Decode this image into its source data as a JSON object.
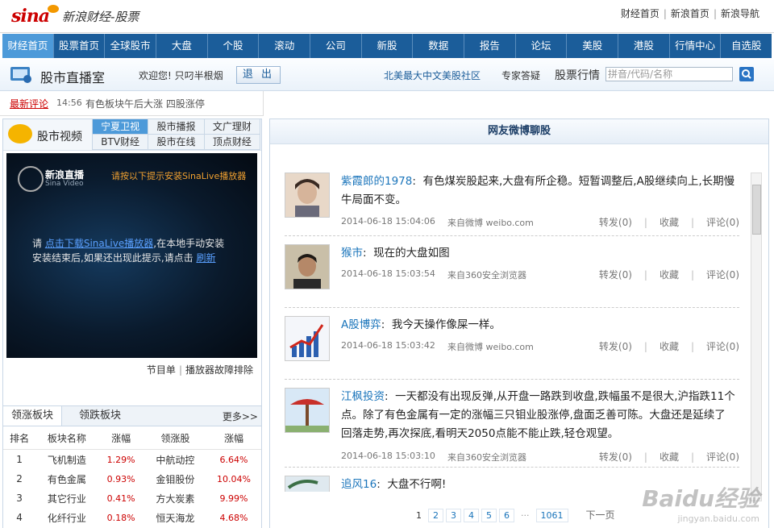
{
  "brand": {
    "logo": "sina",
    "name": "新浪财经-股票"
  },
  "top_links": [
    "财经首页",
    "新浪首页",
    "新浪导航"
  ],
  "nav": [
    "财经首页",
    "股票首页",
    "全球股市",
    "大盘",
    "个股",
    "滚动",
    "公司",
    "新股",
    "数据",
    "报告",
    "论坛",
    "美股",
    "港股",
    "行情中心",
    "自选股"
  ],
  "room": {
    "title": "股市直播室",
    "welcome": "欢迎您!  只叼半根烟",
    "logout": "退 出",
    "community": "北美最大中文美股社区",
    "expert": "专家答疑",
    "quote_label": "股票行情",
    "search_placeholder": "拼音/代码/名称"
  },
  "ticker": {
    "label": "最新评论",
    "time": "14:56",
    "text": "有色板块午后大涨  四股涨停"
  },
  "video": {
    "title": "股市视频",
    "tabs": [
      "宁夏卫视",
      "股市播报",
      "文广理财",
      "BTV财经",
      "股市在线",
      "顶点财经"
    ],
    "player_name": "新浪直播",
    "player_sub": "Sina Video",
    "player_hint": "请按以下提示安装SinaLive播放器",
    "msg_1": "请 ",
    "msg_link": "点击下载SinaLive播放器",
    "msg_2": ",在本地手动安装",
    "msg_3": "安装结束后,如果还出现此提示,请点击 ",
    "msg_refresh": "刷新",
    "links": [
      "节目单",
      "播放器故障排除"
    ]
  },
  "sectors": {
    "tabs": [
      "领涨板块",
      "领跌板块"
    ],
    "more": "更多>>",
    "headers": [
      "排名",
      "板块名称",
      "涨幅",
      "领涨股",
      "涨幅"
    ],
    "rows": [
      [
        "1",
        "飞机制造",
        "1.29%",
        "中航动控",
        "6.64%"
      ],
      [
        "2",
        "有色金属",
        "0.93%",
        "金钼股份",
        "10.04%"
      ],
      [
        "3",
        "其它行业",
        "0.41%",
        "方大炭素",
        "9.99%"
      ],
      [
        "4",
        "化纤行业",
        "0.18%",
        "恒天海龙",
        "4.68%"
      ]
    ]
  },
  "weibo": {
    "title": "网友微博聊股",
    "posts": [
      {
        "user": "紫霞郎的1978",
        "text": "有色煤炭股起来,大盘有所企稳。短暂调整后,A股继续向上,长期慢牛局面不变。",
        "time": "2014-06-18 15:04:06",
        "source": "来自微博 weibo.com",
        "repost": "转发(0)",
        "fav": "收藏",
        "comment": "评论(0)"
      },
      {
        "user": "猴市",
        "text": "现在的大盘如图",
        "time": "2014-06-18 15:03:54",
        "source": "来自360安全浏览器",
        "repost": "转发(0)",
        "fav": "收藏",
        "comment": "评论(0)"
      },
      {
        "user": "A股博弈",
        "text": "我今天操作像屎一样。",
        "time": "2014-06-18 15:03:42",
        "source": "来自微博 weibo.com",
        "repost": "转发(0)",
        "fav": "收藏",
        "comment": "评论(0)"
      },
      {
        "user": "江枫投资",
        "text": "一天都没有出现反弹,从开盘一路跌到收盘,跌幅虽不是很大,沪指跌11个点。除了有色金属有一定的涨幅三只钼业股涨停,盘面乏善可陈。大盘还是延续了回落走势,再次探底,看明天2050点能不能止跌,轻仓观望。",
        "time": "2014-06-18 15:03:10",
        "source": "来自360安全浏览器",
        "repost": "转发(0)",
        "fav": "收藏",
        "comment": "评论(0)"
      },
      {
        "user": "追风16",
        "text": "大盘不行啊!",
        "time": "",
        "source": "",
        "repost": "",
        "fav": "",
        "comment": ""
      }
    ],
    "pager": [
      "1",
      "2",
      "3",
      "4",
      "5",
      "6",
      "···",
      "1061"
    ],
    "next": "下一页"
  },
  "watermark": {
    "main": "Baidu经验",
    "sub": "jingyan.baidu.com"
  }
}
